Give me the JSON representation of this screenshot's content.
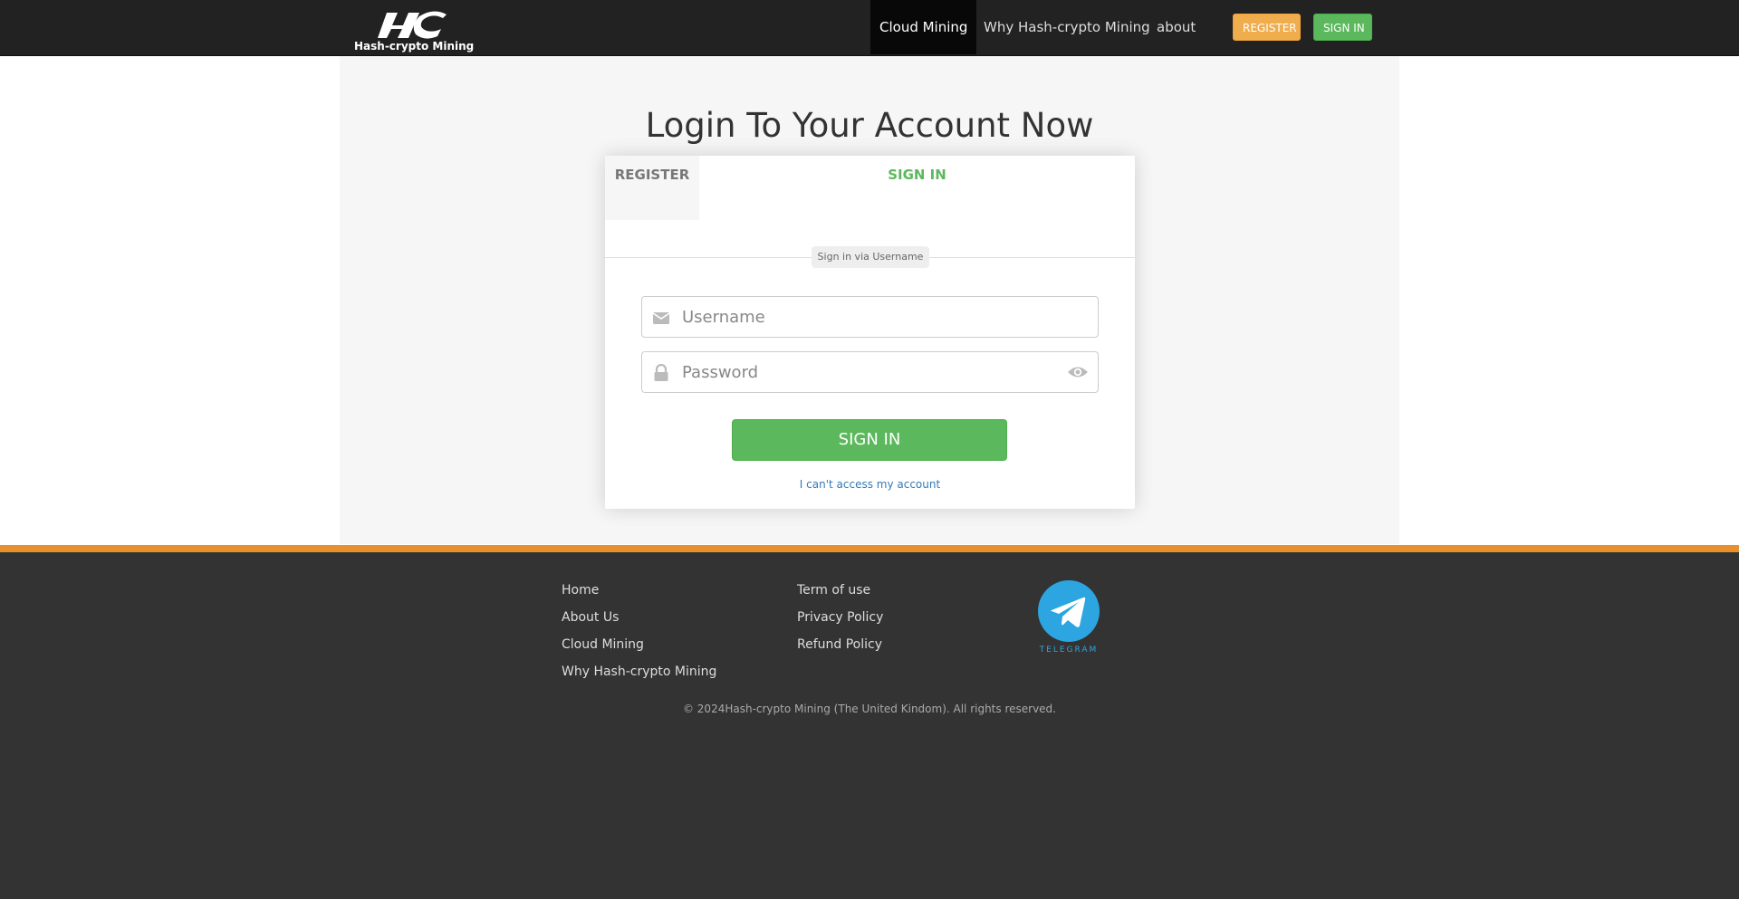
{
  "brand": {
    "logo_text": "Hash-crypto  Mining"
  },
  "nav": {
    "items": [
      {
        "label": "Cloud Mining",
        "active": true
      },
      {
        "label": "Why Hash-crypto Mining",
        "active": false
      },
      {
        "label": "about",
        "active": false
      }
    ],
    "register_label": "REGISTER",
    "signin_label": "SIGN IN"
  },
  "main": {
    "title": "Login To Your Account Now",
    "tabs": {
      "register": "REGISTER",
      "signin": "SIGN IN"
    },
    "divider_label": "Sign in via Username",
    "username": {
      "placeholder": "Username",
      "value": "",
      "icon": "envelope-icon"
    },
    "password": {
      "placeholder": "Password",
      "value": "",
      "icon": "lock-icon",
      "toggle_icon": "eye-icon"
    },
    "submit_label": "SIGN IN",
    "access_link": "I can't access my account"
  },
  "footer": {
    "col1": [
      "Home",
      "About Us",
      "Cloud Mining",
      "Why Hash-crypto Mining"
    ],
    "col2": [
      "Term of use",
      "Privacy Policy",
      "Refund Policy"
    ],
    "social_label": "TELEGRAM",
    "copyright": "© 2024Hash-crypto Mining (The United Kindom). All rights reserved."
  },
  "colors": {
    "nav_bg": "#222222",
    "accent_green": "#5cb85c",
    "accent_orange": "#f0ad4e",
    "footer_stripe": "#e8902c",
    "footer_bg": "#333333",
    "telegram_blue": "#2ca5e0",
    "link_blue": "#337ab7"
  }
}
